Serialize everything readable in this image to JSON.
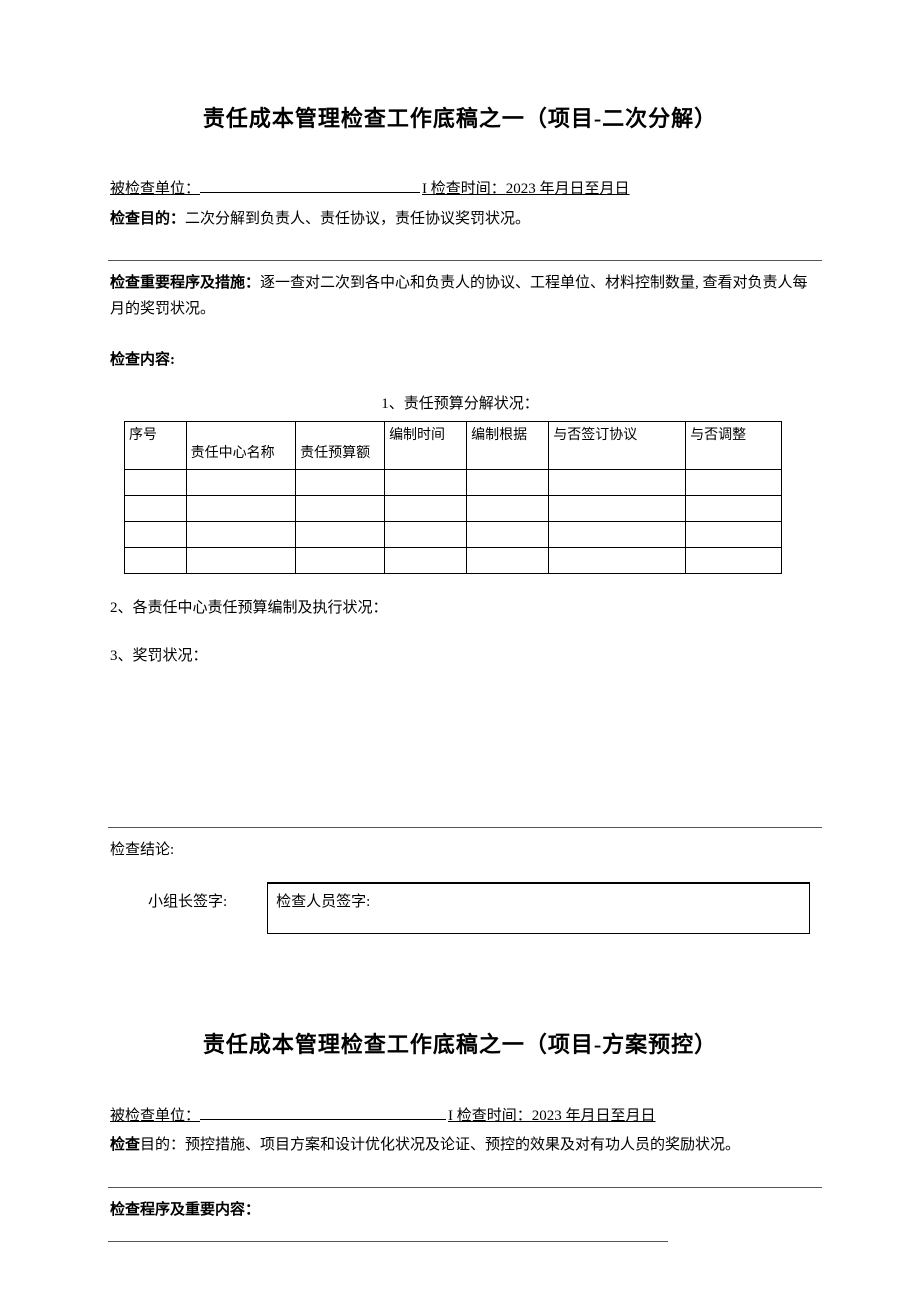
{
  "section1": {
    "title": "责任成本管理检查工作底稿之一（项目-二次分解）",
    "unit_label": "被检查单位：",
    "time_label": "I 检查时间：",
    "time_value": "2023 年月日至月日",
    "purpose_label": "检查目的：",
    "purpose_text": "二次分解到负责人、责任协议，责任协议奖罚状况。",
    "procedure_label": "检查重要程序及措施：",
    "procedure_text": "逐一查对二次到各中心和负责人的协议、工程单位、材料控制数量, 查看对负责人每月的奖罚状况。",
    "content_label": "检查内容:",
    "table_caption": "1、责任预算分解状况：",
    "headers": {
      "c1": "序号",
      "c2": "责任中心名称",
      "c3": "责任预算额",
      "c4": "编制时间",
      "c5": "编制根据",
      "c6": "与否签订协议",
      "c7": "与否调整"
    },
    "item2": "2、各责任中心责任预算编制及执行状况：",
    "item3": "3、奖罚状况：",
    "conclusion_label": "检查结论:",
    "sign_leader": "小组长签字:",
    "sign_inspector": "检查人员签字:"
  },
  "section2": {
    "title": "责任成本管理检查工作底稿之一（项目-方案预控）",
    "unit_label": "被检查单位：",
    "time_label": "I 检查时间：",
    "time_value": "2023 年月日至月日",
    "purpose_label": "检查",
    "purpose_text": "目的：预控措施、项目方案和设计优化状况及论证、预控的效果及对有功人员的奖励状况。",
    "procedure_label": "检查程序及重要内容："
  }
}
